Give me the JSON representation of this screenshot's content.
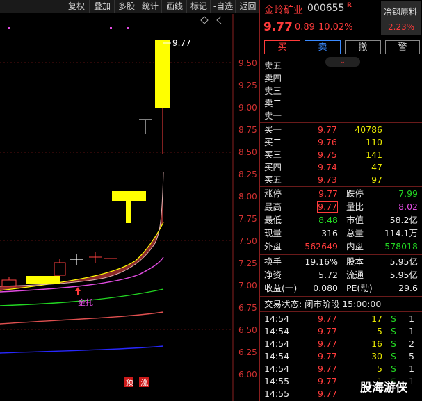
{
  "toolbar": {
    "items": [
      "复权",
      "叠加",
      "多股",
      "统计",
      "画线",
      "标记",
      "-自选",
      "返回"
    ]
  },
  "chart": {
    "y_ticks": [
      "9.50",
      "9.25",
      "9.00",
      "8.75",
      "8.50",
      "8.25",
      "8.00",
      "7.75",
      "7.50",
      "7.25",
      "7.00",
      "6.75",
      "6.50",
      "6.25",
      "6.00"
    ],
    "high_label": "9.77",
    "annotation": "金托",
    "badges": [
      "预",
      "涨"
    ],
    "watermark": "股海游侠",
    "colors": {
      "up": "#ffff00",
      "band": "#8b2a2a",
      "ma1": "#ffff00",
      "ma2": "#e24ce2",
      "ma3": "#22d622",
      "ma4": "#e05050",
      "ma5": "#2828ff"
    }
  },
  "stock": {
    "name": "金岭矿业",
    "code": "000655",
    "r_flag": "R",
    "price": "9.77",
    "change": "0.89",
    "change_pct": "10.02%",
    "industry": "冶钢原料",
    "industry_pct": "2.23%"
  },
  "actions": [
    "买",
    "卖",
    "撤",
    "警"
  ],
  "sell_orders": [
    {
      "label": "卖五",
      "price": "",
      "vol": ""
    },
    {
      "label": "卖四",
      "price": "",
      "vol": ""
    },
    {
      "label": "卖三",
      "price": "",
      "vol": ""
    },
    {
      "label": "卖二",
      "price": "",
      "vol": ""
    },
    {
      "label": "卖一",
      "price": "",
      "vol": ""
    }
  ],
  "buy_orders": [
    {
      "label": "买一",
      "price": "9.77",
      "vol": "40786"
    },
    {
      "label": "买二",
      "price": "9.76",
      "vol": "110"
    },
    {
      "label": "买三",
      "price": "9.75",
      "vol": "141"
    },
    {
      "label": "买四",
      "price": "9.74",
      "vol": "47"
    },
    {
      "label": "买五",
      "price": "9.73",
      "vol": "97"
    }
  ],
  "quote": {
    "rows": [
      {
        "l1": "涨停",
        "v1": "9.77",
        "c1": "red",
        "l2": "跌停",
        "v2": "7.99",
        "c2": "green"
      },
      {
        "l1": "最高",
        "v1": "9.77",
        "c1": "red",
        "l2": "量比",
        "v2": "8.02",
        "c2": "mag"
      },
      {
        "l1": "最低",
        "v1": "8.48",
        "c1": "green",
        "l2": "市值",
        "v2": "58.2亿",
        "c2": "white"
      },
      {
        "l1": "现量",
        "v1": "316",
        "c1": "white",
        "l2": "总量",
        "v2": "114.1万",
        "c2": "white"
      },
      {
        "l1": "外盘",
        "v1": "562649",
        "c1": "red",
        "l2": "内盘",
        "v2": "578018",
        "c2": "green"
      }
    ],
    "rows2": [
      {
        "l1": "换手",
        "v1": "19.16%",
        "l2": "股本",
        "v2": "5.95亿"
      },
      {
        "l1": "净资",
        "v1": "5.72",
        "l2": "流通",
        "v2": "5.95亿"
      },
      {
        "l1": "收益(一)",
        "v1": "0.080",
        "l2": "PE(动)",
        "v2": "29.6"
      }
    ]
  },
  "trade_status": "交易状态: 闭市阶段 15:00:00",
  "ticks": [
    {
      "time": "14:54",
      "price": "9.77",
      "vol": "17",
      "side": "S",
      "n": "1"
    },
    {
      "time": "14:54",
      "price": "9.77",
      "vol": "5",
      "side": "S",
      "n": "1"
    },
    {
      "time": "14:54",
      "price": "9.77",
      "vol": "16",
      "side": "S",
      "n": "2"
    },
    {
      "time": "14:54",
      "price": "9.77",
      "vol": "30",
      "side": "S",
      "n": "5"
    },
    {
      "time": "14:54",
      "price": "9.77",
      "vol": "5",
      "side": "S",
      "n": "1"
    },
    {
      "time": "14:55",
      "price": "9.77",
      "vol": "1",
      "side": "S",
      "n": "1"
    },
    {
      "time": "14:55",
      "price": "9.77",
      "vol": "",
      "side": "",
      "n": ""
    }
  ]
}
